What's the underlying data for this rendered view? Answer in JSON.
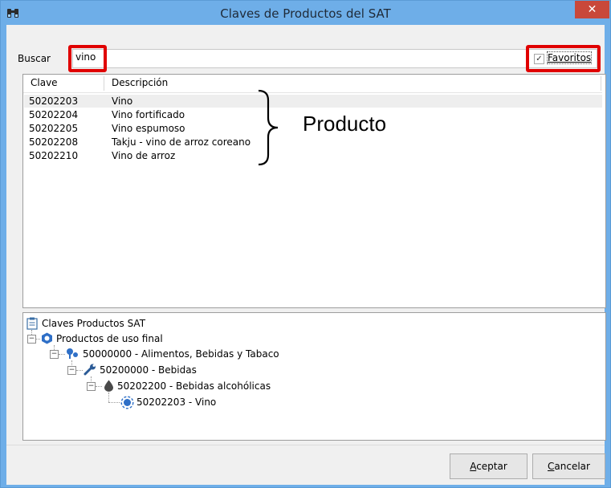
{
  "window": {
    "title": "Claves de Productos del SAT",
    "app_icon": "binoculars-icon",
    "close_glyph": "✕"
  },
  "search": {
    "label": "Buscar",
    "value": "vino"
  },
  "favorites": {
    "label": "Favoritos",
    "checked": true,
    "check_glyph": "✓"
  },
  "list": {
    "columns": [
      "Clave",
      "Descripción"
    ],
    "rows": [
      {
        "clave": "50202203",
        "descripcion": "Vino"
      },
      {
        "clave": "50202204",
        "descripcion": "Vino fortificado"
      },
      {
        "clave": "50202205",
        "descripcion": "Vino espumoso"
      },
      {
        "clave": "50202208",
        "descripcion": "Takju - vino de arroz coreano"
      },
      {
        "clave": "50202210",
        "descripcion": "Vino de arroz"
      }
    ]
  },
  "annotation": {
    "text": "Producto"
  },
  "tree": {
    "root": "Claves Productos SAT",
    "level1": "Productos de uso final",
    "level2": "50000000 - Alimentos, Bebidas y Tabaco",
    "level3": "50200000 - Bebidas",
    "level4": "50202200 - Bebidas alcohólicas",
    "level5": "50202203 - Vino",
    "expander_glyph": "−"
  },
  "buttons": {
    "accept_first": "A",
    "accept_rest": "ceptar",
    "cancel_first": "C",
    "cancel_rest": "ancelar"
  },
  "colors": {
    "titlebar": "#6eaee8",
    "close": "#c9483a",
    "highlight_box": "#e00000"
  }
}
